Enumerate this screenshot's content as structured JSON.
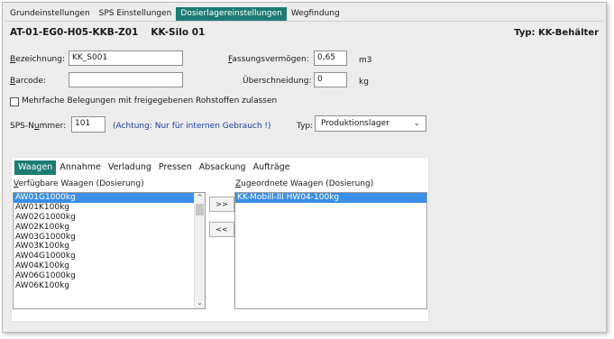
{
  "tabs": [
    {
      "label": "Grundeinstellungen"
    },
    {
      "label": "SPS Einstellungen"
    },
    {
      "label": "Dosierlagereinstellungen"
    },
    {
      "label": "Wegfindung"
    }
  ],
  "header": {
    "code": "AT-01-EG0-H05-KKB-Z01",
    "name": "KK-Silo 01",
    "typ": "Typ: KK-Behälter"
  },
  "form": {
    "bezeichnung_label_underlined": "B",
    "bezeichnung_label_rest": "ezeichnung:",
    "bezeichnung_value": "KK_S001",
    "barcode_label_underlined": "B",
    "barcode_label_rest": "arcode:",
    "barcode_value": "",
    "fassung_label_underlined": "F",
    "fassung_label_rest": "assungsvermögen:",
    "fassung_value": "0,65",
    "fassung_unit": "m3",
    "ueber_label": "Überschneidung:",
    "ueber_value": "0",
    "ueber_unit": "kg",
    "mehrfach_label": "Mehrfache Belegungen mit freigegebenen Rohstoffen zulassen",
    "sps_label_pre": "SPS-N",
    "sps_label_underlined": "u",
    "sps_label_rest": "mmer:",
    "sps_value": "101",
    "sps_hint": "(Achtung: Nur für internen Gebrauch !)",
    "typ_label": "Typ:",
    "typ_value": "Produktionslager"
  },
  "subtabs": [
    {
      "label": "Waagen"
    },
    {
      "label": "Annahme"
    },
    {
      "label": "Verladung"
    },
    {
      "label": "Pressen"
    },
    {
      "label": "Absackung"
    },
    {
      "label": "Aufträge"
    }
  ],
  "lists": {
    "available_label_underlined": "V",
    "available_label_rest": "erfügbare Waagen (Dosierung)",
    "assigned_label_underlined": "Z",
    "assigned_label_rest": "ugeordnete Waagen (Dosierung)",
    "available": [
      "AW01G1000kg",
      "AW01K100kg",
      "AW02G1000kg",
      "AW02K100kg",
      "AW03G1000kg",
      "AW03K100kg",
      "AW04G1000kg",
      "AW04K100kg",
      "AW06G1000kg",
      "AW06K100kg"
    ],
    "assigned": [
      "KK-Mobill-III HW04-100kg"
    ],
    "add_label": ">>",
    "remove_label": "<<"
  }
}
